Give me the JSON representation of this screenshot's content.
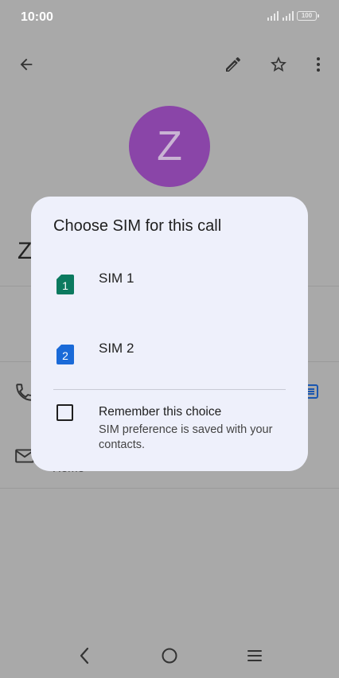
{
  "status_bar": {
    "time": "10:00",
    "battery": "100"
  },
  "app_bar": {
    "back_icon": "arrow-left-icon",
    "edit_icon": "pencil-icon",
    "favorite_icon": "star-outline-icon",
    "more_icon": "more-vertical-icon"
  },
  "contact": {
    "avatar_letter": "Z",
    "name_initial": "Z",
    "email_type_partial": "Home"
  },
  "dialog": {
    "title": "Choose SIM for this call",
    "options": [
      {
        "label": "SIM 1",
        "badge": "1",
        "color": "#0b7a5f"
      },
      {
        "label": "SIM 2",
        "badge": "2",
        "color": "#1a6ad8"
      }
    ],
    "remember": {
      "title": "Remember this choice",
      "subtitle": "SIM preference is saved with your contacts."
    }
  },
  "colors": {
    "scrim": "#a9a9a9",
    "dialog_bg": "#eef0fb",
    "avatar": "#8a45a8",
    "accent_blue": "#1a6ad8"
  }
}
